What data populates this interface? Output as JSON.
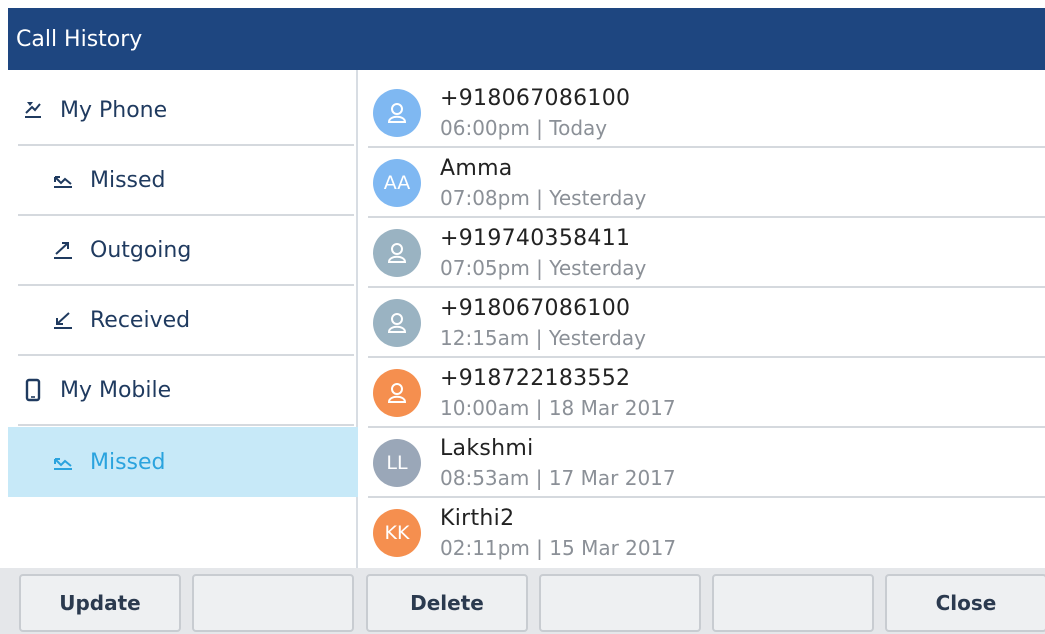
{
  "title": "Call History",
  "sidebar": {
    "items": [
      {
        "label": "My Phone",
        "icon": "phone-history-icon"
      },
      {
        "label": "Missed",
        "icon": "missed-call-icon"
      },
      {
        "label": "Outgoing",
        "icon": "outgoing-call-icon"
      },
      {
        "label": "Received",
        "icon": "received-call-icon"
      },
      {
        "label": "My Mobile",
        "icon": "mobile-phone-icon"
      },
      {
        "label": "Missed",
        "icon": "missed-call-icon",
        "selected": true
      }
    ]
  },
  "calls": [
    {
      "name": "+918067086100",
      "time": "06:00pm",
      "date": "Today",
      "initials": "",
      "avatar_color": "#7fb8f2",
      "icon": "person-icon"
    },
    {
      "name": "Amma",
      "time": "07:08pm",
      "date": "Yesterday",
      "initials": "AA",
      "avatar_color": "#7fb8f2",
      "icon": ""
    },
    {
      "name": "+919740358411",
      "time": "07:05pm",
      "date": "Yesterday",
      "initials": "",
      "avatar_color": "#9ab3c2",
      "icon": "person-icon"
    },
    {
      "name": "+918067086100",
      "time": "12:15am",
      "date": "Yesterday",
      "initials": "",
      "avatar_color": "#9ab3c2",
      "icon": "person-icon"
    },
    {
      "name": "+918722183552",
      "time": "10:00am",
      "date": "18 Mar 2017",
      "initials": "",
      "avatar_color": "#f58f4f",
      "icon": "person-icon"
    },
    {
      "name": "Lakshmi",
      "time": "08:53am",
      "date": "17 Mar 2017",
      "initials": "LL",
      "avatar_color": "#9aa7b8",
      "icon": ""
    },
    {
      "name": "Kirthi2",
      "time": "02:11pm",
      "date": "15 Mar 2017",
      "initials": "KK",
      "avatar_color": "#f58f4f",
      "icon": ""
    }
  ],
  "footer": {
    "buttons": [
      "Update",
      "",
      "Delete",
      "",
      "",
      "Close"
    ]
  },
  "colors": {
    "titlebar": "#1e4680",
    "selected_bg": "#c7e9f8",
    "selected_text": "#2aa3de"
  }
}
